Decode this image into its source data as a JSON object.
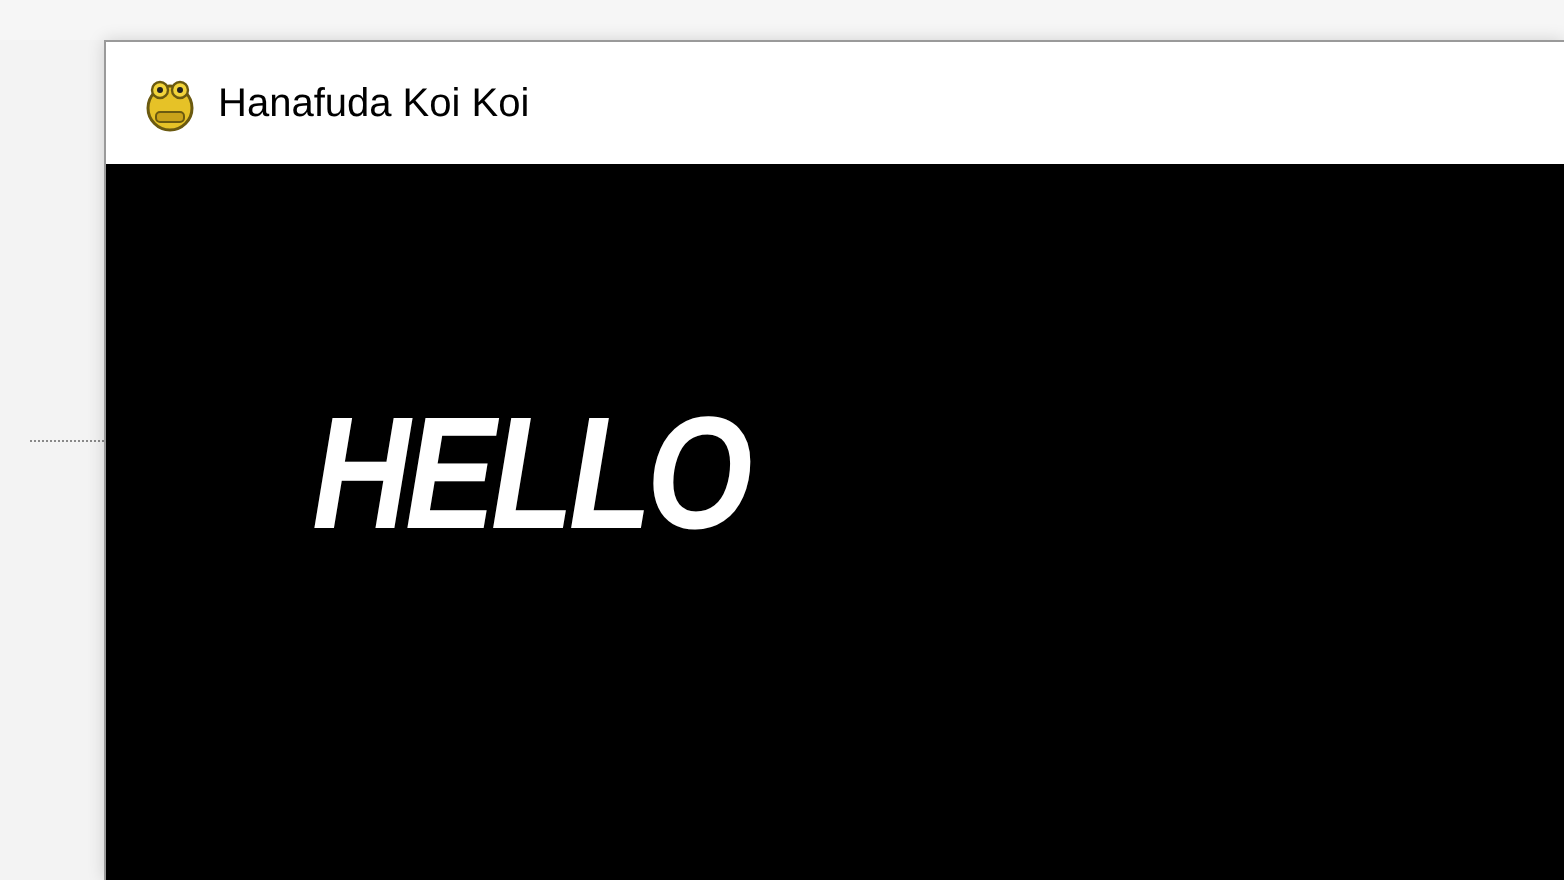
{
  "window": {
    "title": "Hanafuda Koi Koi"
  },
  "canvas": {
    "text": "HELLO"
  }
}
